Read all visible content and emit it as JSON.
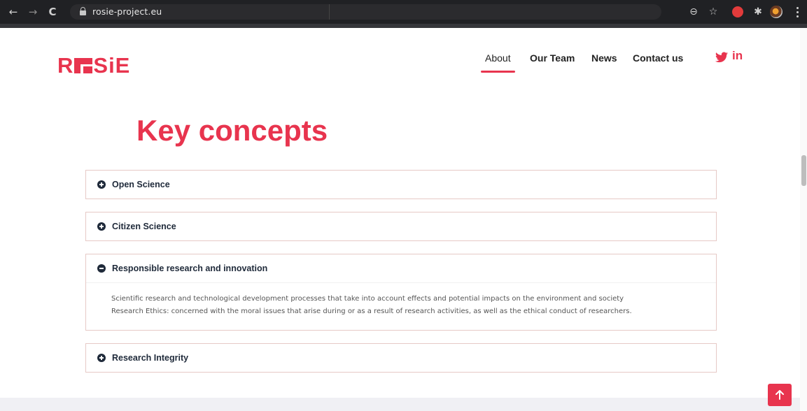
{
  "browser": {
    "url": "rosie-project.eu",
    "back_glyph": "←",
    "forward_glyph": "→",
    "reload_glyph": "C",
    "zoom_glyph": "⊖",
    "star_glyph": "☆",
    "puzzle_glyph": "✱"
  },
  "site": {
    "logo": {
      "left": "R",
      "right": "SiE"
    },
    "nav": [
      {
        "label": "About",
        "active": true
      },
      {
        "label": "Our Team",
        "active": false
      },
      {
        "label": "News",
        "active": false
      },
      {
        "label": "Contact us",
        "active": false
      }
    ],
    "social": {
      "linkedin": "in"
    },
    "accent": "#e8344e"
  },
  "main": {
    "title": "Key concepts",
    "accordion": [
      {
        "label": "Open Science",
        "expanded": false
      },
      {
        "label": "Citizen Science",
        "expanded": false
      },
      {
        "label": "Responsible research and innovation",
        "expanded": true,
        "body": [
          "Scientific research and technological development processes that take into account effects and potential impacts on the environment and society",
          "Research Ethics: concerned with the moral issues that arise during or as a result of research activities, as well as the ethical conduct of researchers."
        ]
      },
      {
        "label": "Research Integrity",
        "expanded": false
      }
    ]
  }
}
